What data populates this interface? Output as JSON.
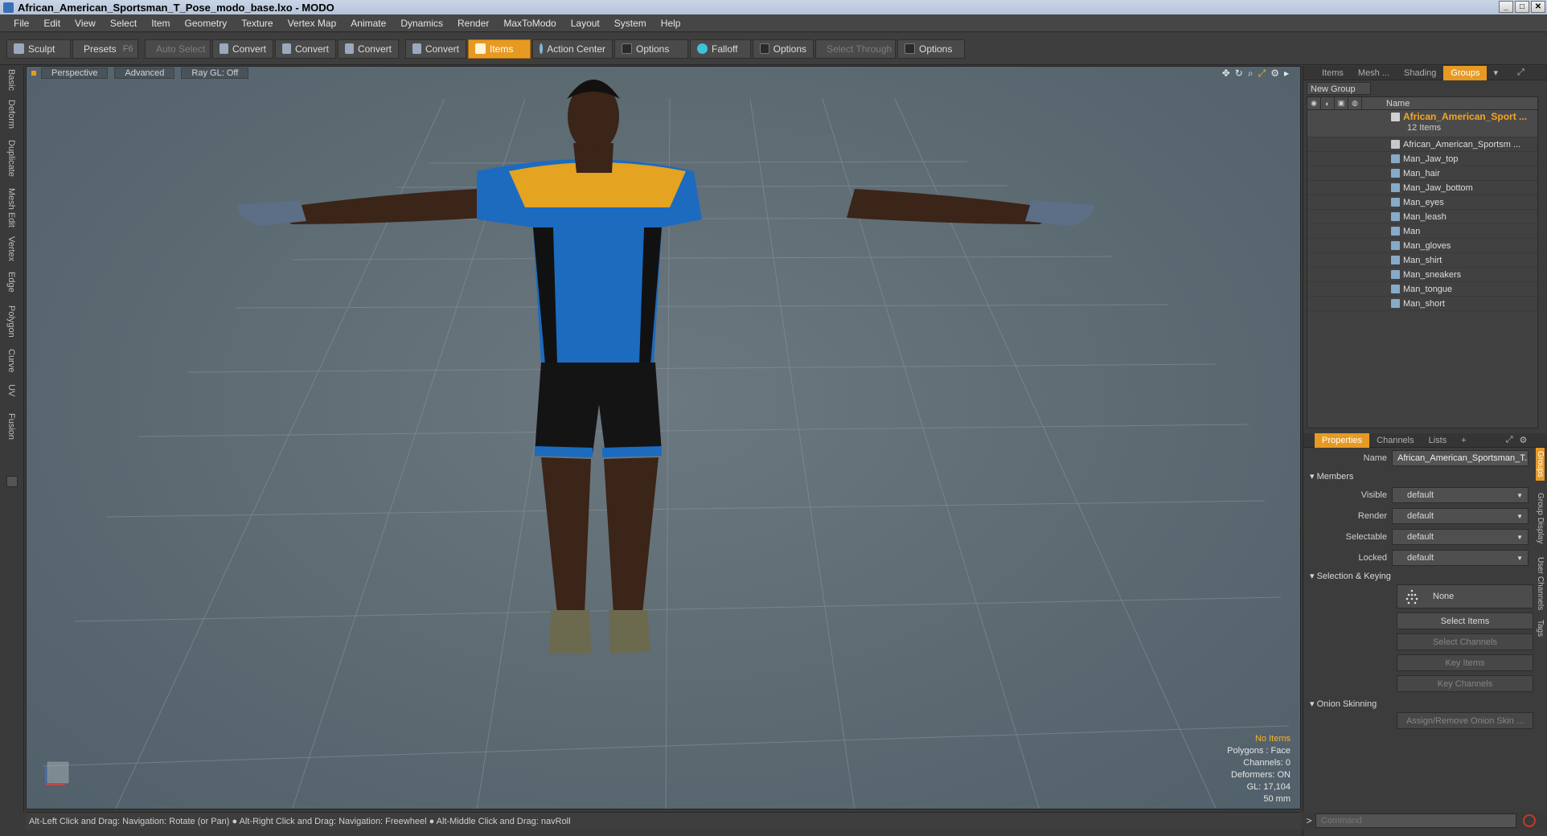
{
  "window": {
    "title": "African_American_Sportsman_T_Pose_modo_base.lxo - MODO",
    "min": "_",
    "max": "□",
    "close": "✕"
  },
  "menu": [
    "File",
    "Edit",
    "View",
    "Select",
    "Item",
    "Geometry",
    "Texture",
    "Vertex Map",
    "Animate",
    "Dynamics",
    "Render",
    "MaxToModo",
    "Layout",
    "System",
    "Help"
  ],
  "toolbar": {
    "sculpt": "Sculpt",
    "presets": "Presets",
    "presets_key": "F6",
    "auto_select": "Auto Select",
    "convert1": "Convert",
    "convert2": "Convert",
    "convert3": "Convert",
    "convert4": "Convert",
    "items": "Items",
    "action_center": "Action Center",
    "options1": "Options",
    "falloff": "Falloff",
    "options2": "Options",
    "select_through": "Select Through",
    "options3": "Options"
  },
  "left_tabs": [
    "Basic",
    "Deform",
    "Duplicate",
    "Mesh Edit",
    "Vertex",
    "Edge",
    "Polygon",
    "Curve",
    "UV",
    "Fusion"
  ],
  "viewport": {
    "view": "Perspective",
    "shading": "Advanced",
    "raygl": "Ray GL: Off",
    "info": {
      "selection": "No Items",
      "polygons": "Polygons : Face",
      "channels": "Channels: 0",
      "deformers": "Deformers: ON",
      "gl": "GL: 17,104",
      "lens": "50 mm"
    }
  },
  "status": "Alt-Left Click and Drag: Navigation: Rotate (or Pan) ● Alt-Right Click and Drag: Navigation: Freewheel ● Alt-Middle Click and Drag: navRoll",
  "panel_tabs": [
    "Items",
    "Mesh ...",
    "Shading",
    "Groups"
  ],
  "new_group": "New Group",
  "tree": {
    "col_name": "Name",
    "group_name": "African_American_Sport ...",
    "group_count": "12 Items",
    "items": [
      "African_American_Sportsm ...",
      "Man_Jaw_top",
      "Man_hair",
      "Man_Jaw_bottom",
      "Man_eyes",
      "Man_leash",
      "Man",
      "Man_gloves",
      "Man_shirt",
      "Man_sneakers",
      "Man_tongue",
      "Man_short"
    ]
  },
  "props_tabs": [
    "Properties",
    "Channels",
    "Lists",
    "+"
  ],
  "props": {
    "name_label": "Name",
    "name_value": "African_American_Sportsman_T...",
    "members": "Members",
    "visible_label": "Visible",
    "visible_value": "default",
    "render_label": "Render",
    "render_value": "default",
    "selectable_label": "Selectable",
    "selectable_value": "default",
    "locked_label": "Locked",
    "locked_value": "default",
    "selection_keying": "Selection & Keying",
    "none": "None",
    "select_items": "Select Items",
    "select_channels": "Select Channels",
    "key_items": "Key Items",
    "key_channels": "Key Channels",
    "onion_skinning": "Onion Skinning",
    "assign_onion": "Assign/Remove Onion Skin ..."
  },
  "right_vtabs": [
    "Groups",
    "Group Display",
    "User Channels",
    "Tags"
  ],
  "command": {
    "prompt": ">",
    "placeholder": "Command"
  },
  "colors": {
    "accent": "#e79a22",
    "group_highlight": "#f5a623"
  }
}
